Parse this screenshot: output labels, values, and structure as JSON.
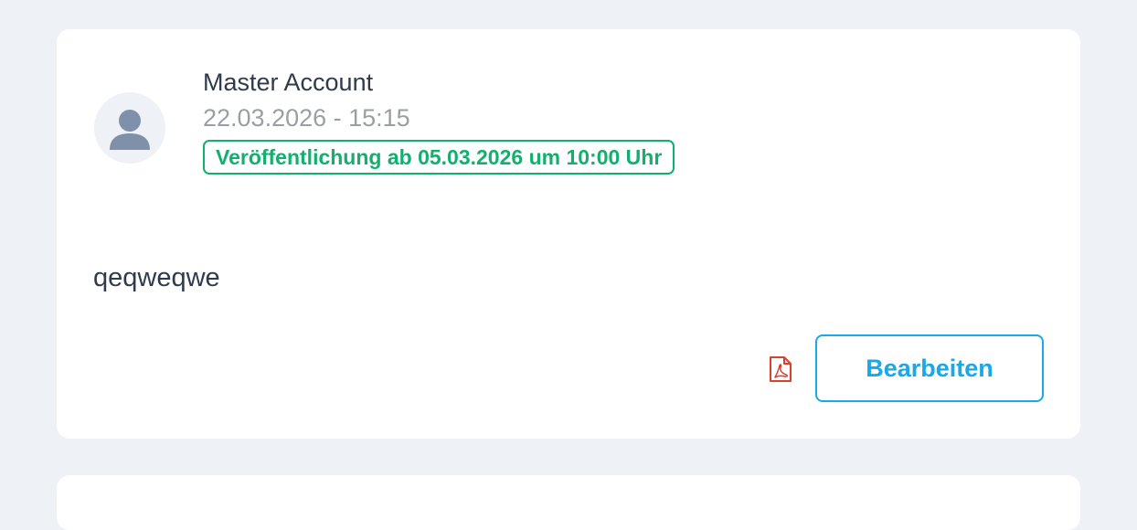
{
  "post": {
    "author": "Master Account",
    "date": "22.03.2026 - 15:15",
    "publish_badge": "Veröffentlichung ab 05.03.2026 um 10:00 Uhr",
    "content": "qeqweqwe",
    "attachment_icon": "pdf-icon",
    "edit_label": "Bearbeiten"
  },
  "colors": {
    "background": "#eef1f5",
    "card": "#ffffff",
    "text_primary": "#2f3a4c",
    "text_muted": "#9a9fa6",
    "badge_green": "#12b06e",
    "accent_blue": "#1aa8e8",
    "pdf_red": "#d9412c",
    "avatar_icon": "#7f91aa"
  }
}
